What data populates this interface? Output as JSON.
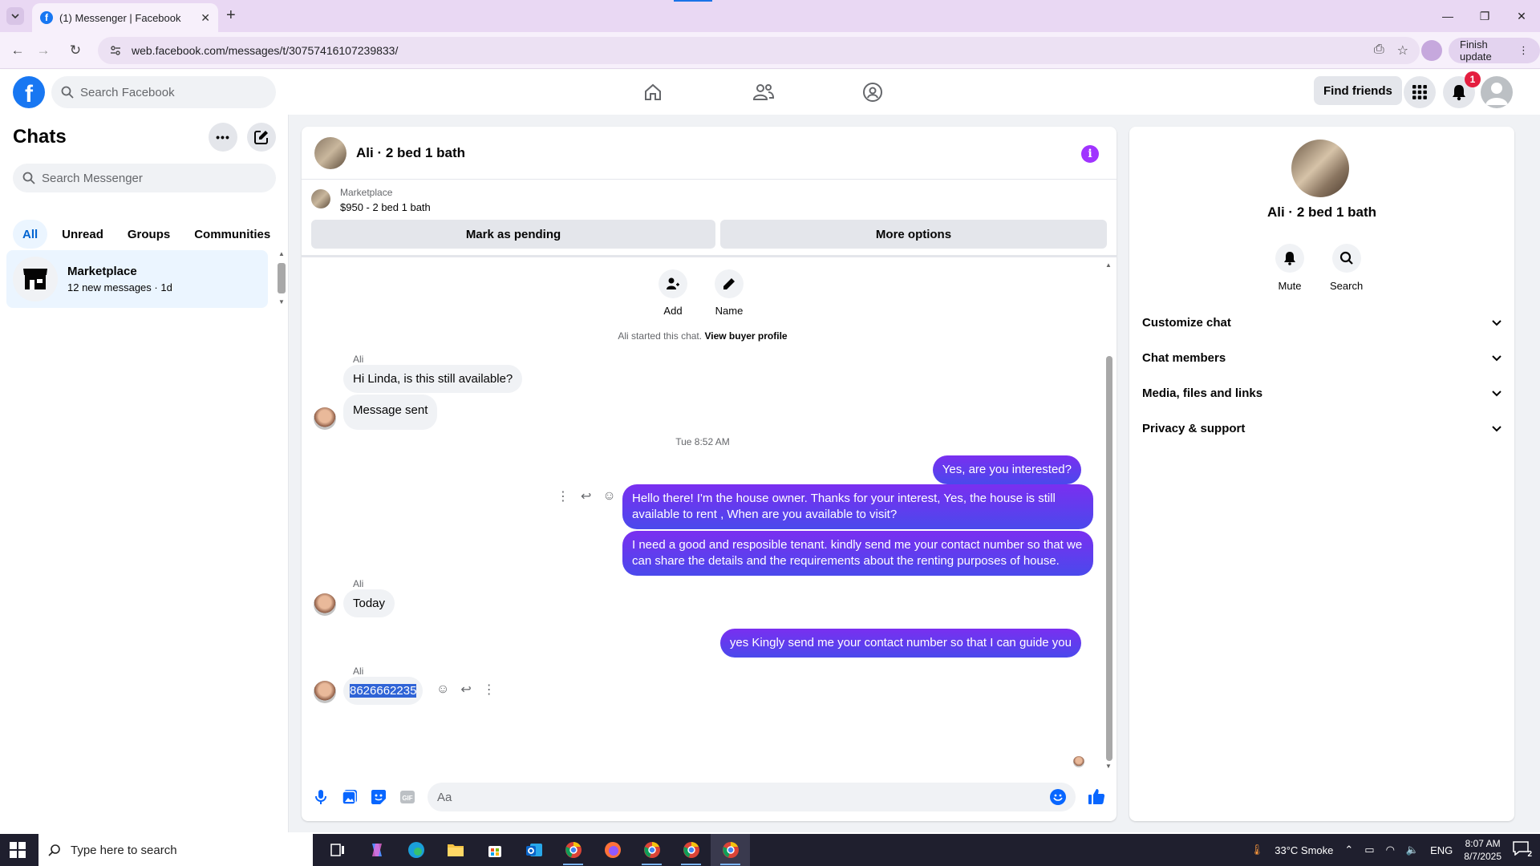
{
  "browser": {
    "tab_title": "(1) Messenger | Facebook",
    "url": "web.facebook.com/messages/t/30757416107239833/",
    "finish_update": "Finish update"
  },
  "header": {
    "search_placeholder": "Search Facebook",
    "find_friends": "Find friends",
    "notification_count": "1"
  },
  "sidebar": {
    "title": "Chats",
    "search_placeholder": "Search Messenger",
    "filters": [
      "All",
      "Unread",
      "Groups",
      "Communities"
    ],
    "chats": [
      {
        "name": "Marketplace",
        "subtitle": "12 new messages · 1d"
      }
    ]
  },
  "conversation": {
    "title": "Ali · 2 bed 1 bath",
    "marketplace_label": "Marketplace",
    "listing": "$950 - 2 bed 1 bath",
    "mark_pending": "Mark as pending",
    "more_options": "More options",
    "add_label": "Add",
    "name_label": "Name",
    "started_text": "Ali started this chat.",
    "buyer_profile": "View buyer profile",
    "messages": [
      {
        "sender": "Ali",
        "text": "Hi Linda, is this still available?"
      },
      {
        "text": "Message sent"
      },
      {
        "timestamp": "Tue 8:52 AM"
      },
      {
        "text": "Yes, are you interested?"
      },
      {
        "text": "Hello there! I'm the house owner. Thanks for your interest, Yes, the house is still available to rent , When are you available to visit?"
      },
      {
        "text": "I need a good and resposible tenant.  kindly send me your contact number so that we can share the details and the requirements about the renting purposes of house."
      },
      {
        "sender": "Ali",
        "text": "Today"
      },
      {
        "text": "yes Kingly send me your contact number so that I can guide you"
      },
      {
        "sender": "Ali",
        "text": "8626662235"
      }
    ],
    "composer_placeholder": "Aa"
  },
  "details": {
    "name": "Ali · 2 bed 1 bath",
    "mute": "Mute",
    "search": "Search",
    "sections": [
      "Customize chat",
      "Chat members",
      "Media, files and links",
      "Privacy & support"
    ]
  },
  "taskbar": {
    "search_placeholder": "Type here to search",
    "weather": "33°C  Smoke",
    "language": "ENG",
    "time": "8:07 AM",
    "date": "8/7/2025",
    "notifications": "2"
  },
  "colors": {
    "fb_blue": "#1877f2",
    "outgoing_bubble": "#5b35ee",
    "incoming_bubble": "#f0f2f5"
  }
}
